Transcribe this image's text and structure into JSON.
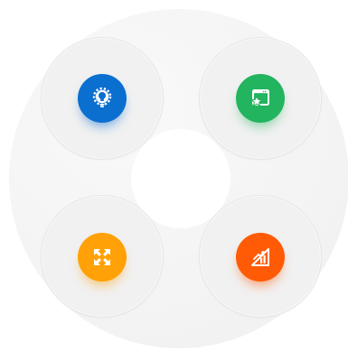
{
  "colors": {
    "idea": "#0b6fcf",
    "star": "#22b45e",
    "expand": "#ffa107",
    "chart": "#ff5b06"
  },
  "nodes": [
    {
      "id": "top-left",
      "icon": "lightbulb-gear-icon"
    },
    {
      "id": "top-right",
      "icon": "star-window-icon"
    },
    {
      "id": "bottom-left",
      "icon": "expand-arrows-icon"
    },
    {
      "id": "bottom-right",
      "icon": "chart-growth-icon"
    }
  ]
}
